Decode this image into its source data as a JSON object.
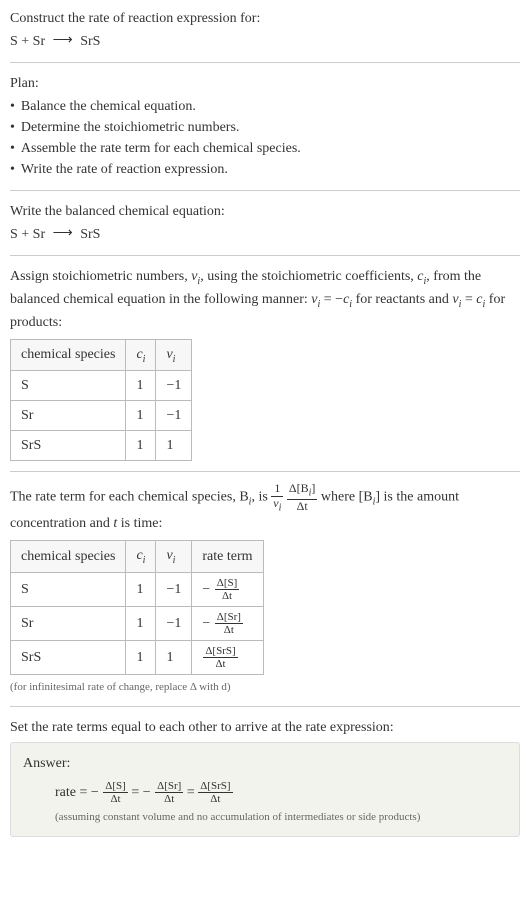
{
  "intro": {
    "prompt": "Construct the rate of reaction expression for:",
    "reaction_lhs": "S + Sr",
    "arrow": "⟶",
    "reaction_rhs": "SrS"
  },
  "plan": {
    "title": "Plan:",
    "items": [
      "Balance the chemical equation.",
      "Determine the stoichiometric numbers.",
      "Assemble the rate term for each chemical species.",
      "Write the rate of reaction expression."
    ]
  },
  "balanced": {
    "title": "Write the balanced chemical equation:",
    "reaction_lhs": "S + Sr",
    "arrow": "⟶",
    "reaction_rhs": "SrS"
  },
  "stoich": {
    "text_1": "Assign stoichiometric numbers, ",
    "nu_i": "ν",
    "sub_i": "i",
    "text_2": ", using the stoichiometric coefficients, ",
    "c_i": "c",
    "text_3": ", from the balanced chemical equation in the following manner: ",
    "eq1_lhs": "ν",
    "eq1_eq": " = −",
    "eq1_rhs": "c",
    "text_4": " for reactants and ",
    "eq2_lhs": "ν",
    "eq2_eq": " = ",
    "eq2_rhs": "c",
    "text_5": " for products:",
    "headers": {
      "species": "chemical species",
      "ci": "c",
      "nui": "ν"
    },
    "rows": [
      {
        "species": "S",
        "ci": "1",
        "nui": "−1"
      },
      {
        "species": "Sr",
        "ci": "1",
        "nui": "−1"
      },
      {
        "species": "SrS",
        "ci": "1",
        "nui": "1"
      }
    ]
  },
  "rateterm": {
    "text_1": "The rate term for each chemical species, B",
    "text_2": ", is ",
    "frac1_num": "1",
    "frac1_den_sym": "ν",
    "frac2_num_delta": "Δ[B",
    "frac2_num_close": "]",
    "frac2_den": "Δt",
    "text_3": " where [B",
    "text_4": "] is the amount concentration and ",
    "t_sym": "t",
    "text_5": " is time:",
    "headers": {
      "species": "chemical species",
      "ci": "c",
      "nui": "ν",
      "rate": "rate term"
    },
    "rows": [
      {
        "species": "S",
        "ci": "1",
        "nui": "−1",
        "sign": "−",
        "num": "Δ[S]",
        "den": "Δt"
      },
      {
        "species": "Sr",
        "ci": "1",
        "nui": "−1",
        "sign": "−",
        "num": "Δ[Sr]",
        "den": "Δt"
      },
      {
        "species": "SrS",
        "ci": "1",
        "nui": "1",
        "sign": "",
        "num": "Δ[SrS]",
        "den": "Δt"
      }
    ],
    "note": "(for infinitesimal rate of change, replace Δ with d)"
  },
  "final": {
    "title": "Set the rate terms equal to each other to arrive at the rate expression:"
  },
  "answer": {
    "label": "Answer:",
    "rate_word": "rate = ",
    "eq": " = ",
    "neg": "−",
    "term1_num": "Δ[S]",
    "term1_den": "Δt",
    "term2_num": "Δ[Sr]",
    "term2_den": "Δt",
    "term3_num": "Δ[SrS]",
    "term3_den": "Δt",
    "note": "(assuming constant volume and no accumulation of intermediates or side products)"
  },
  "sub_i": "i"
}
